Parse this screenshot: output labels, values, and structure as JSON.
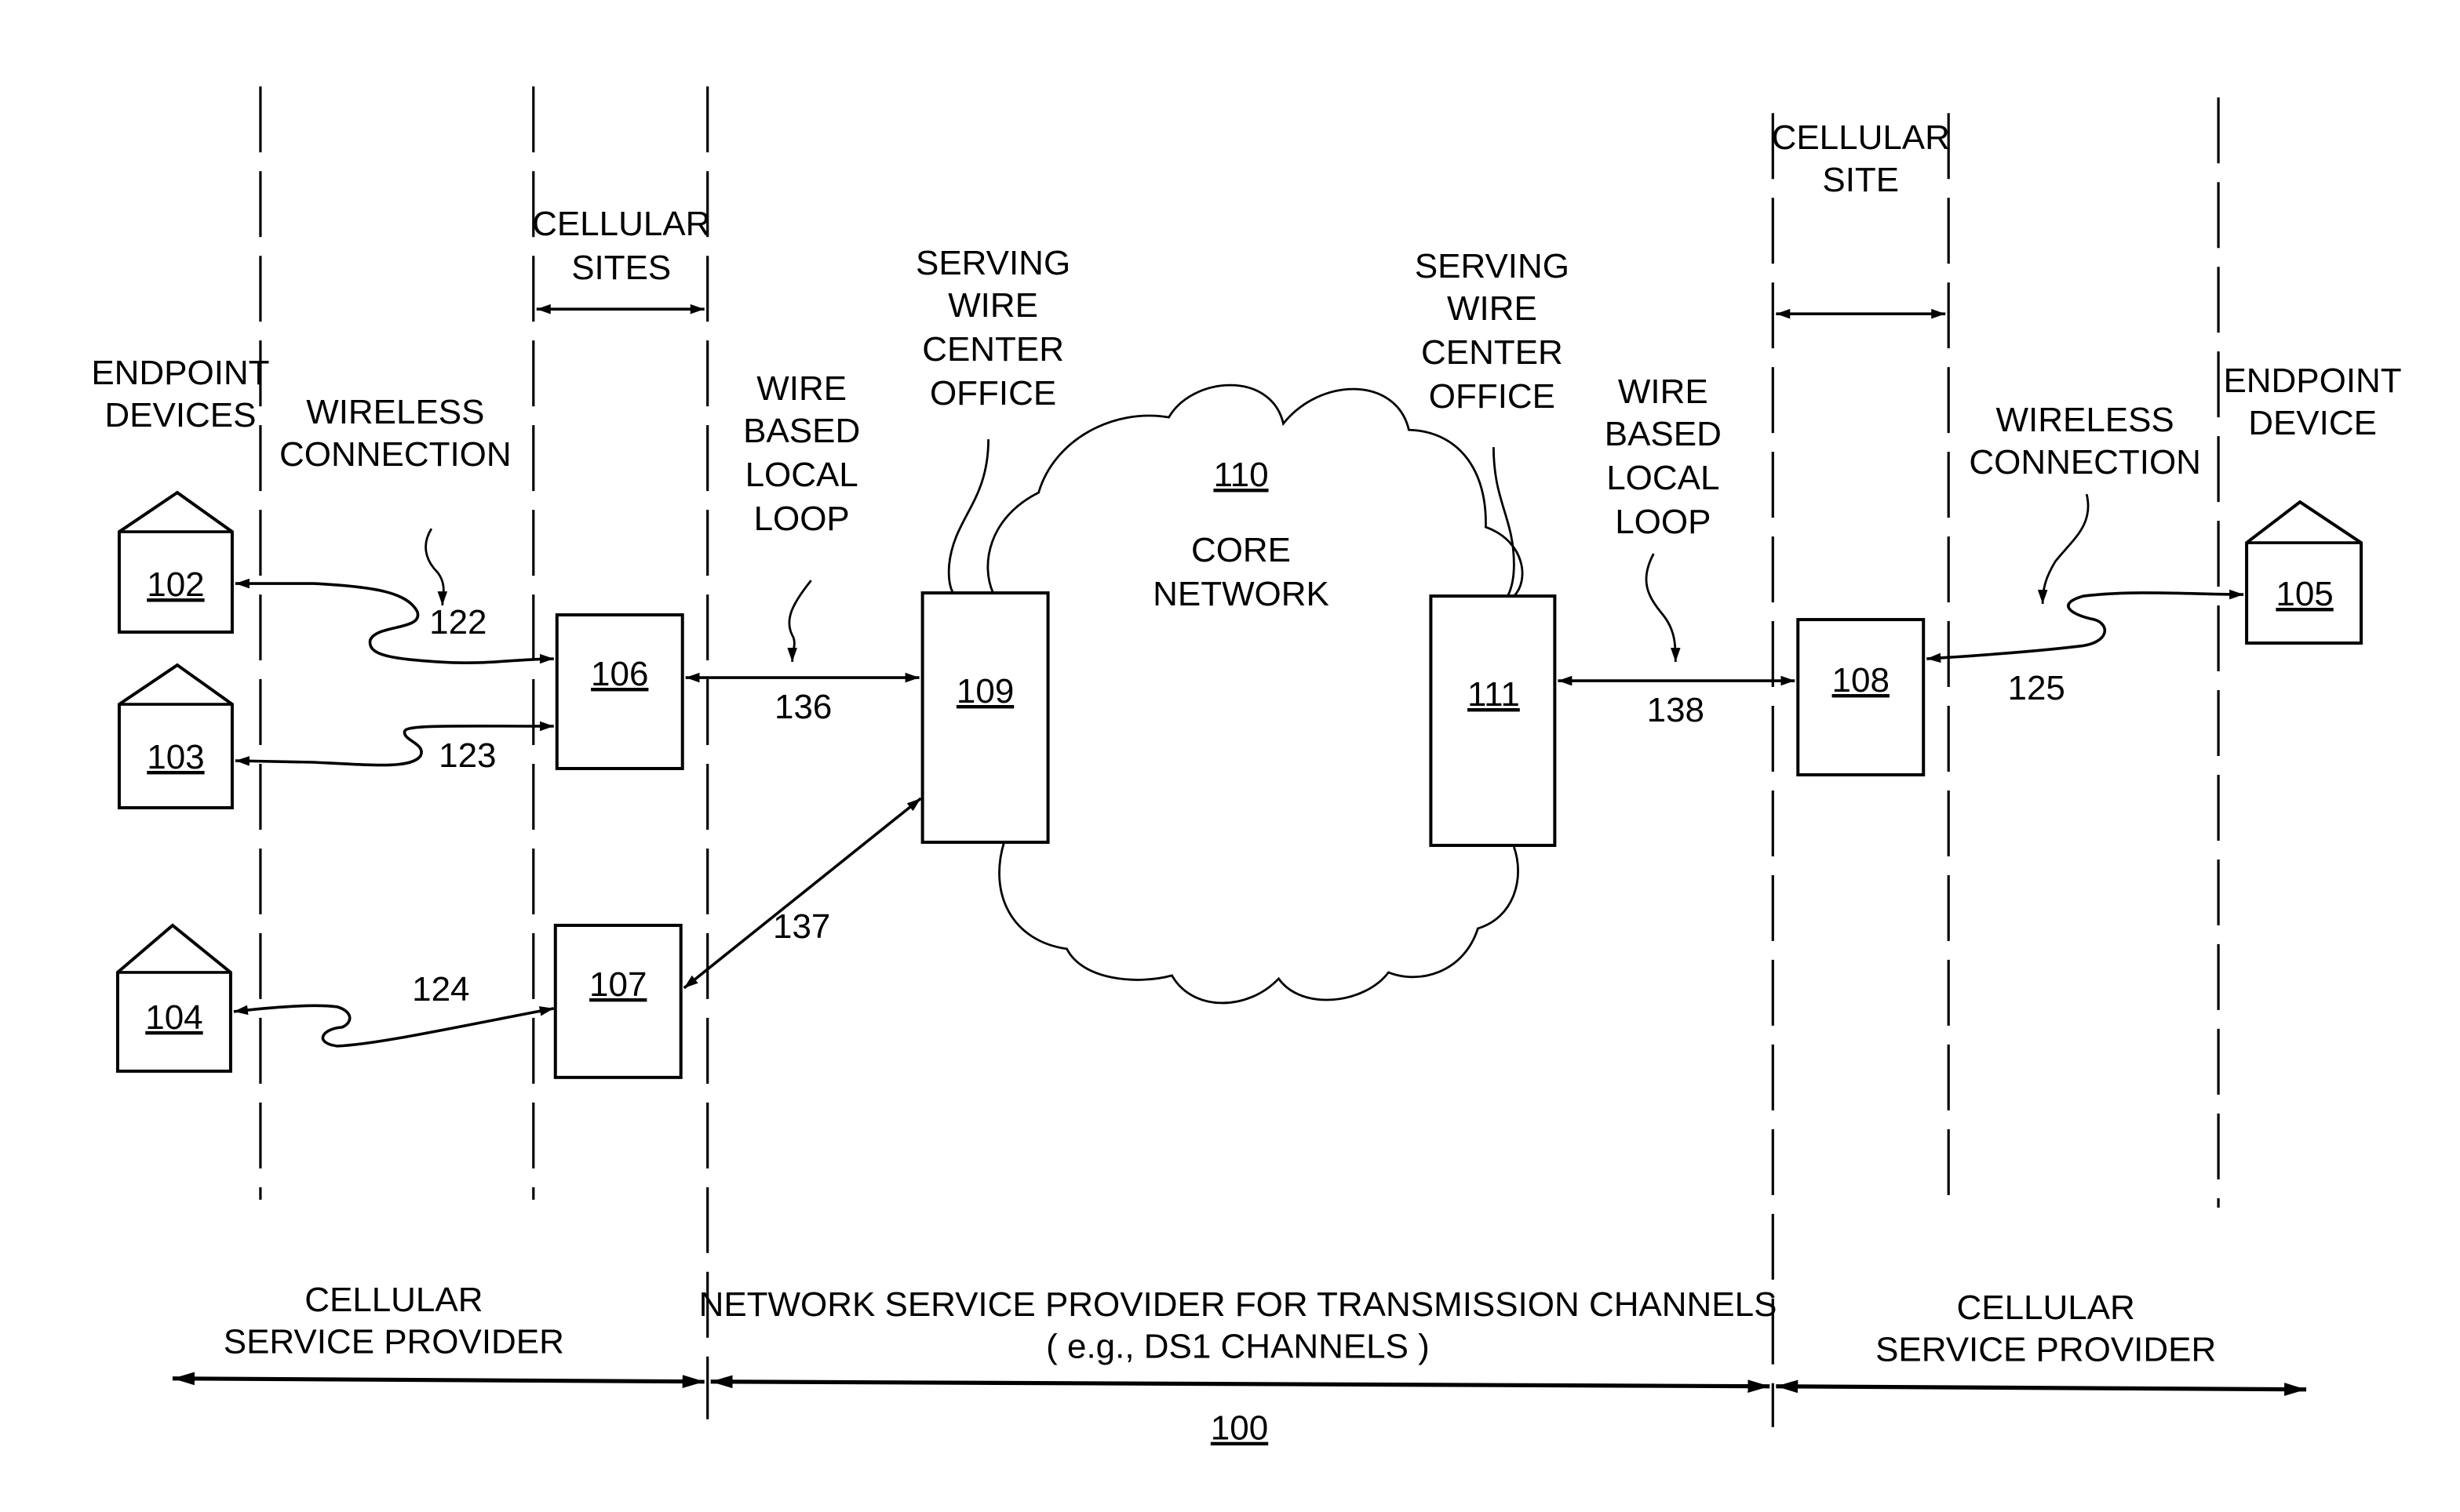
{
  "figure": {
    "ref": "100",
    "labels": {
      "endpoint_devices": [
        "ENDPOINT",
        "DEVICES"
      ],
      "endpoint_device": [
        "ENDPOINT",
        "DEVICE"
      ],
      "wireless_connection": [
        "WIRELESS",
        "CONNECTION"
      ],
      "cellular_sites": [
        "CELLULAR",
        "SITES"
      ],
      "cellular_site": [
        "CELLULAR",
        "SITE"
      ],
      "wire_based_local_loop": [
        "WIRE",
        "BASED",
        "LOCAL",
        "LOOP"
      ],
      "serving_wire_center_office": [
        "SERVING",
        "WIRE",
        "CENTER",
        "OFFICE"
      ],
      "core_network": [
        "CORE",
        "NETWORK"
      ]
    },
    "devices": [
      {
        "id": "102"
      },
      {
        "id": "103"
      },
      {
        "id": "104"
      },
      {
        "id": "105"
      }
    ],
    "cell_sites": [
      {
        "id": "106"
      },
      {
        "id": "107"
      },
      {
        "id": "108"
      }
    ],
    "wire_centers": [
      {
        "id": "109"
      },
      {
        "id": "111"
      }
    ],
    "core_network_ref": "110",
    "connections": {
      "c122": "122",
      "c123": "123",
      "c124": "124",
      "c125": "125",
      "c136": "136",
      "c137": "137",
      "c138": "138"
    },
    "bottom": {
      "left": [
        "CELLULAR",
        "SERVICE PROVIDER"
      ],
      "middle": [
        "NETWORK SERVICE PROVIDER FOR TRANSMISSION CHANNELS",
        "( e.g., DS1 CHANNELS )"
      ],
      "right": [
        "CELLULAR",
        "SERVICE PROVIDER"
      ]
    }
  }
}
